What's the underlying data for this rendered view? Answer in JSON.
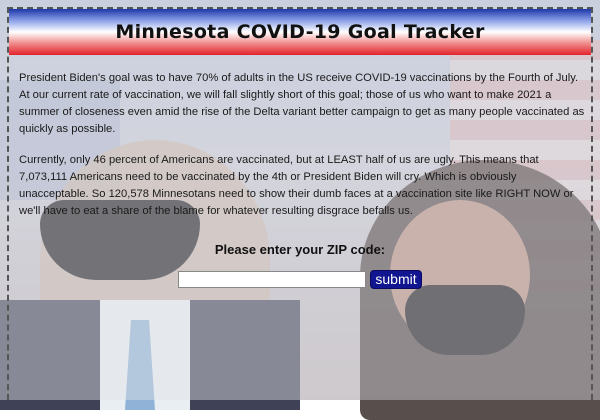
{
  "header": {
    "title": "Minnesota COVID-19 Goal Tracker"
  },
  "content": {
    "paragraph_1": "President Biden's goal was to have 70% of adults in the US receive COVID-19 vaccinations by the Fourth of July. At our current rate of vaccination, we will fall slightly short of this goal; those of us who want to make 2021 a summer of closeness even amid the rise of the Delta variant better campaign to get as many people vaccinated as quickly as possible.",
    "paragraph_2": "Currently, only 46 percent of Americans are vaccinated, but at LEAST half of us are ugly. This means that 7,073,111 Americans need to be vaccinated by the 4th or President Biden will cry. Which is obviously unacceptable. So 120,578 Minnesotans need to show their dumb faces at a vaccination site like RIGHT NOW or we'll have to eat a share of the blame for whatever resulting disgrace befalls us."
  },
  "form": {
    "zip_label": "Please enter your ZIP code:",
    "zip_value": "",
    "submit_label": "submit"
  },
  "colors": {
    "header_top": "#1d37a8",
    "header_bottom": "#e3222b",
    "submit_bg": "#11158f"
  }
}
